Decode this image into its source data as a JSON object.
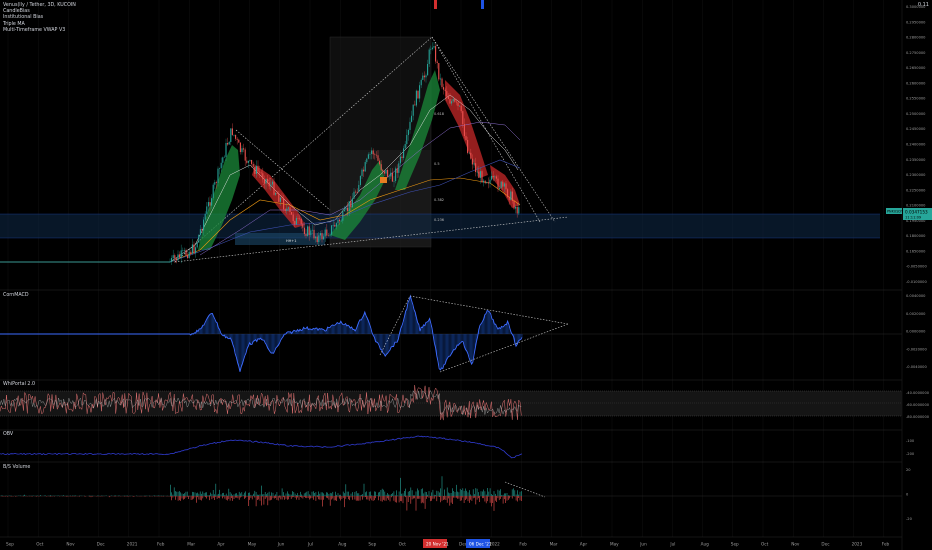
{
  "header": {
    "symbol_title": "Venus(lly / Tether, 3D, KUCOIN",
    "indicators": [
      "CandleBias",
      "Institutional Bias",
      "Triple MA",
      "Multi-Timeframe VWAP V3"
    ],
    "top_right_price": "0.11"
  },
  "price_axis": {
    "labels": [
      "0.3000000",
      "0.2950000",
      "0.2800000",
      "0.2750000",
      "0.2650000",
      "0.2600000",
      "0.2550000",
      "0.2500000",
      "0.2450000",
      "0.2400000",
      "0.2350000",
      "0.2300000",
      "0.2250000",
      "0.2100000",
      "0.1950000",
      "0.1800000",
      "0.1650000",
      "-0.0050000",
      "-0.0100000"
    ],
    "last_price_tag": "0.0347153",
    "last_price_sub": "11:11:09",
    "left_tag": "PNKUSDT"
  },
  "macd_pane": {
    "title": "CornMACD",
    "axis_labels": [
      "0.0040000",
      "0.0020000",
      "0.0000000",
      "-0.0020000",
      "-0.0040000"
    ]
  },
  "rsi_pane": {
    "title": "WhiPortal 2.0",
    "axis_labels": [
      "-40.0000000",
      "-60.0000000",
      "-80.0000000"
    ]
  },
  "obv_pane": {
    "title": "OBV",
    "axis_labels": [
      "-100",
      "-200"
    ]
  },
  "vol_pane": {
    "title": "B/S Volume",
    "axis_labels": [
      "20",
      "0",
      "-20"
    ]
  },
  "time_axis": {
    "labels": [
      "Sep",
      "Oct",
      "Nov",
      "Dec",
      "2021",
      "Feb",
      "Mar",
      "Apr",
      "May",
      "Jun",
      "Jul",
      "Aug",
      "Sep",
      "Oct",
      "Nov",
      "Dec",
      "2022",
      "Feb",
      "Mar",
      "Apr",
      "May",
      "Jun",
      "Jul",
      "Aug",
      "Sep",
      "Oct",
      "Nov",
      "Dec",
      "2023",
      "Feb"
    ],
    "highlight_1": "20 Nov '21",
    "highlight_2": "06 Dec '21"
  },
  "annotations": {
    "fib_labels": [
      "0.618",
      "0.5",
      "0.382",
      "0.236"
    ],
    "box_label": "HH+1"
  },
  "colors": {
    "bg": "#000000",
    "grid": "#141414",
    "candle_up": "#26a69a",
    "candle_down": "#ef5350",
    "macd": "#2962ff",
    "rsi": "#ef5350",
    "obv": "#2f3bd1",
    "accent_red": "#d32f2f",
    "accent_blue": "#1e53e5"
  }
}
